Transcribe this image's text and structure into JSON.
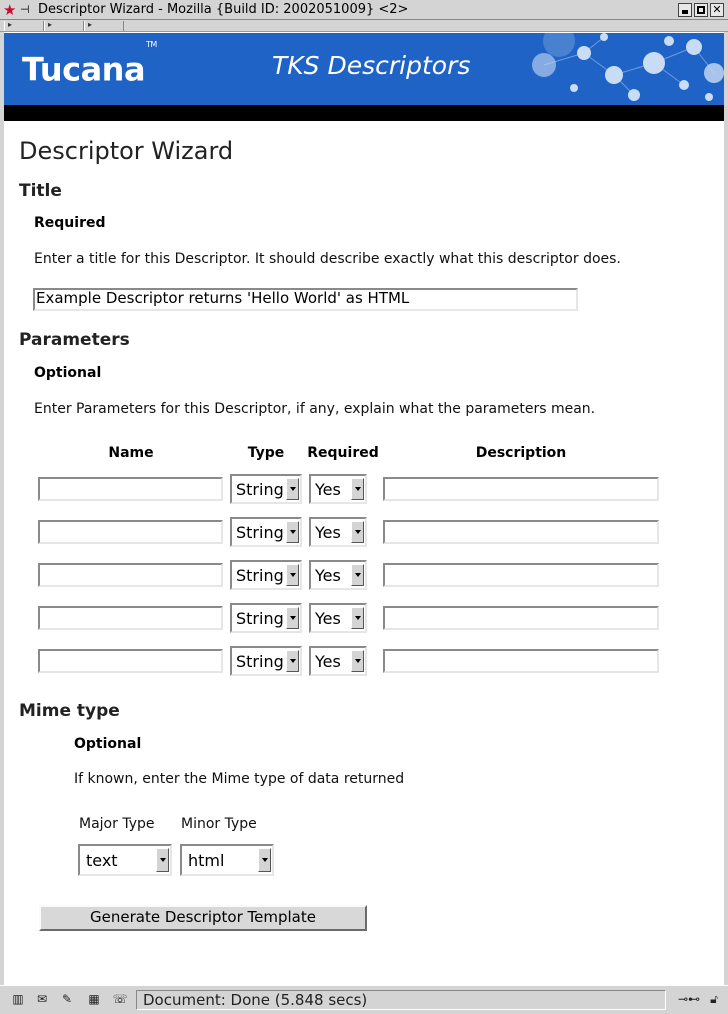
{
  "window": {
    "title": "Descriptor Wizard - Mozilla {Build ID: 2002051009} <2>"
  },
  "banner": {
    "logo": "Tucana",
    "logo_tm": "TM",
    "heading": "TKS Descriptors"
  },
  "page": {
    "title": "Descriptor Wizard",
    "title_section": {
      "heading": "Title",
      "requirement": "Required",
      "instructions": "Enter a title for this Descriptor. It should describe exactly what this descriptor does.",
      "value": "Example Descriptor returns 'Hello World' as HTML"
    },
    "parameters_section": {
      "heading": "Parameters",
      "requirement": "Optional",
      "instructions": "Enter Parameters for this Descriptor, if any, explain what the parameters mean.",
      "columns": {
        "name": "Name",
        "type": "Type",
        "required": "Required",
        "description": "Description"
      },
      "rows": [
        {
          "name": "",
          "type": "String",
          "required": "Yes",
          "description": ""
        },
        {
          "name": "",
          "type": "String",
          "required": "Yes",
          "description": ""
        },
        {
          "name": "",
          "type": "String",
          "required": "Yes",
          "description": ""
        },
        {
          "name": "",
          "type": "String",
          "required": "Yes",
          "description": ""
        },
        {
          "name": "",
          "type": "String",
          "required": "Yes",
          "description": ""
        }
      ]
    },
    "mime_section": {
      "heading": "Mime type",
      "requirement": "Optional",
      "instructions": "If known, enter the Mime type of data returned",
      "major_label": "Major Type",
      "minor_label": "Minor Type",
      "major_value": "text",
      "minor_value": "html"
    },
    "generate_button": "Generate Descriptor Template"
  },
  "statusbar": {
    "text": "Document: Done (5.848 secs)"
  },
  "colors": {
    "banner_blue": "#1f63c6",
    "chrome_gray": "#d4d4d4"
  }
}
